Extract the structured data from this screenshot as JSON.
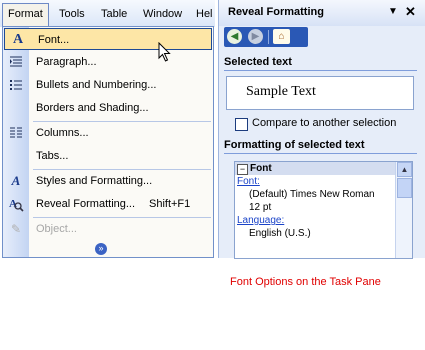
{
  "menubar": {
    "items": [
      "Format",
      "Tools",
      "Table",
      "Window",
      "Hel"
    ]
  },
  "format_menu": {
    "items": [
      {
        "label": "Font...",
        "icon": "font-A-icon",
        "highlighted": true
      },
      {
        "label": "Paragraph...",
        "icon": "paragraph-icon"
      },
      {
        "label": "Bullets and Numbering...",
        "icon": "bullets-icon"
      },
      {
        "label": "Borders and Shading...",
        "icon": ""
      },
      {
        "label": "Columns...",
        "icon": "columns-icon"
      },
      {
        "label": "Tabs...",
        "icon": ""
      },
      {
        "label": "Styles and Formatting...",
        "icon": "styles-icon"
      },
      {
        "label": "Reveal Formatting...",
        "icon": "reveal-icon",
        "shortcut": "Shift+F1"
      },
      {
        "label": "Object...",
        "icon": "object-icon",
        "disabled": true
      }
    ],
    "expand_icon": "chevron-double-down-icon"
  },
  "task_pane": {
    "title": "Reveal Formatting",
    "dropdown_icon": "triangle-down-icon",
    "close_icon": "close-icon",
    "nav": [
      "back-icon",
      "forward-icon",
      "home-icon"
    ],
    "selected_text_heading": "Selected text",
    "sample_text": "Sample Text",
    "compare_label": "Compare to another selection",
    "compare_checked": false,
    "formatting_heading": "Formatting of selected text",
    "tree": {
      "section": "Font",
      "font_link": "Font:",
      "font_value": "(Default) Times New Roman",
      "size_value": "12 pt",
      "language_link": "Language:",
      "language_value": "English (U.S.)"
    }
  },
  "caption": "Font Options on the Task Pane",
  "colors": {
    "highlight": "#fde6a6",
    "highlight_border": "#1e4a95",
    "caption": "#e00000",
    "link": "#1a43c8"
  }
}
